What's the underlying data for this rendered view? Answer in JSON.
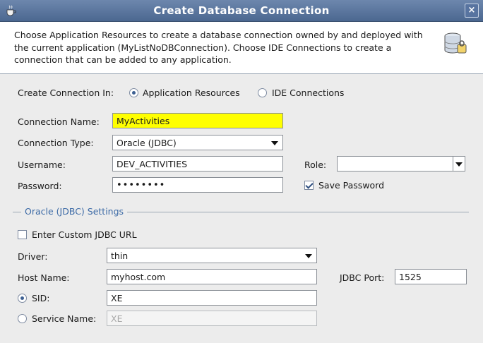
{
  "window": {
    "title": "Create Database Connection",
    "close_label": "×"
  },
  "description": "Choose Application Resources to create a database connection owned by and deployed with the current application (MyListNoDBConnection). Choose IDE Connections to create a connection that can be added to any application.",
  "create_in": {
    "label": "Create Connection In:",
    "option_app": "Application Resources",
    "option_ide": "IDE Connections"
  },
  "connection_name": {
    "label": "Connection Name:",
    "value": "MyActivities"
  },
  "connection_type": {
    "label": "Connection Type:",
    "value": "Oracle (JDBC)"
  },
  "username": {
    "label": "Username:",
    "value": "DEV_ACTIVITIES"
  },
  "role": {
    "label": "Role:",
    "value": ""
  },
  "password": {
    "label": "Password:",
    "value": "••••••••"
  },
  "save_password": {
    "label": "Save Password",
    "checked": true
  },
  "settings": {
    "title": "Oracle (JDBC) Settings",
    "custom_url_label": "Enter Custom JDBC URL",
    "driver": {
      "label": "Driver:",
      "value": "thin"
    },
    "host": {
      "label": "Host Name:",
      "value": "myhost.com"
    },
    "port": {
      "label": "JDBC Port:",
      "value": "1525"
    },
    "sid": {
      "label": "SID:",
      "value": "XE"
    },
    "service": {
      "label": "Service Name:",
      "value": "XE"
    }
  },
  "icons": {
    "app": "coffee-cup-icon",
    "database": "database-icon",
    "close": "close-icon"
  },
  "colors": {
    "title_bar": "#4b6790",
    "highlight": "#ffff00",
    "section_title": "#3c6aa6"
  }
}
